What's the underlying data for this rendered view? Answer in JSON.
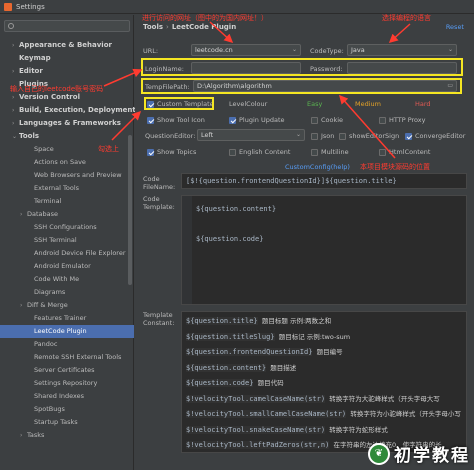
{
  "window": {
    "title": "Settings"
  },
  "search": {
    "placeholder": ""
  },
  "sidebar": {
    "items": [
      {
        "label": "Appearance & Behavior",
        "kind": "top",
        "caret": "›"
      },
      {
        "label": "Keymap",
        "kind": "top",
        "caret": ""
      },
      {
        "label": "Editor",
        "kind": "top",
        "caret": "›"
      },
      {
        "label": "Plugins",
        "kind": "top",
        "caret": ""
      },
      {
        "label": "Version Control",
        "kind": "top",
        "caret": "›"
      },
      {
        "label": "Build, Execution, Deployment",
        "kind": "top",
        "caret": "›"
      },
      {
        "label": "Languages & Frameworks",
        "kind": "top",
        "caret": "›"
      },
      {
        "label": "Tools",
        "kind": "top",
        "caret": "⌄"
      },
      {
        "label": "Space",
        "kind": "child",
        "caret": ""
      },
      {
        "label": "Actions on Save",
        "kind": "child",
        "caret": ""
      },
      {
        "label": "Web Browsers and Preview",
        "kind": "child",
        "caret": ""
      },
      {
        "label": "External Tools",
        "kind": "child",
        "caret": ""
      },
      {
        "label": "Terminal",
        "kind": "child",
        "caret": ""
      },
      {
        "label": "Database",
        "kind": "child-arrow",
        "caret": "›"
      },
      {
        "label": "SSH Configurations",
        "kind": "child",
        "caret": ""
      },
      {
        "label": "SSH Terminal",
        "kind": "child",
        "caret": ""
      },
      {
        "label": "Android Device File Explorer",
        "kind": "child",
        "caret": ""
      },
      {
        "label": "Android Emulator",
        "kind": "child",
        "caret": ""
      },
      {
        "label": "Code With Me",
        "kind": "child",
        "caret": ""
      },
      {
        "label": "Diagrams",
        "kind": "child",
        "caret": ""
      },
      {
        "label": "Diff & Merge",
        "kind": "child-arrow",
        "caret": "›"
      },
      {
        "label": "Features Trainer",
        "kind": "child",
        "caret": ""
      },
      {
        "label": "LeetCode Plugin",
        "kind": "child selected",
        "caret": ""
      },
      {
        "label": "Pandoc",
        "kind": "child",
        "caret": ""
      },
      {
        "label": "Remote SSH External Tools",
        "kind": "child",
        "caret": ""
      },
      {
        "label": "Server Certificates",
        "kind": "child",
        "caret": ""
      },
      {
        "label": "Settings Repository",
        "kind": "child",
        "caret": ""
      },
      {
        "label": "Shared Indexes",
        "kind": "child",
        "caret": ""
      },
      {
        "label": "SpotBugs",
        "kind": "child",
        "caret": ""
      },
      {
        "label": "Startup Tasks",
        "kind": "child",
        "caret": ""
      },
      {
        "label": "Tasks",
        "kind": "child-arrow",
        "caret": "›"
      }
    ]
  },
  "header": {
    "crumb1": "Tools",
    "crumb_sep": "›",
    "crumb2": "LeetCode Plugin",
    "reset": "Reset"
  },
  "form": {
    "url_label": "URL:",
    "url_value": "leetcode.cn",
    "codetype_label": "CodeType:",
    "codetype_value": "Java",
    "login_label": "LoginName:",
    "login_value": "",
    "password_label": "Password:",
    "password_value": "",
    "tempfile_label": "TempFilePath:",
    "tempfile_value": "D:\\Algorithm\\algorithm",
    "custom_template": "Custom Template",
    "level_colour": "LevelColour",
    "easy": "Easy",
    "medium": "Medium",
    "hard": "Hard",
    "show_tool_icon": "Show Tool Icon",
    "plugin_update": "Plugin Update",
    "cookie": "Cookie",
    "http_proxy": "HTTP Proxy",
    "question_editor": "QuestionEditor:",
    "question_editor_value": "Left",
    "json": "Json",
    "show_editor_sign": "showEditorSign",
    "converge_editor": "ConvergeEditor",
    "show_topics": "Show Topics",
    "english_content": "English Content",
    "multiline": "Multiline",
    "html_content": "HtmlContent",
    "custom_config": "CustomConfig(help)",
    "code_filename_label": "Code\nFileName:",
    "code_filename_value": "[$!{question.frontendQuestionId}]${question.title}",
    "code_template_label": "Code\nTemplate:",
    "template_constant_label": "Template\nConstant:"
  },
  "code_template": [
    "${question.content}",
    "",
    "${question.code}"
  ],
  "template_constants": [
    {
      "code": "${question.title}",
      "desc": "题目标题 示例:两数之和"
    },
    {
      "code": "${question.titleSlug}",
      "desc": "题目标记 示例:two-sum"
    },
    {
      "code": "${question.frontendQuestionId}",
      "desc": "题目编号"
    },
    {
      "code": "${question.content}",
      "desc": "题目描述"
    },
    {
      "code": "${question.code}",
      "desc": "题目代码"
    },
    {
      "code": "$!velocityTool.camelCaseName(str)",
      "desc": "转换字符为大驼峰样式（开头字母大写"
    },
    {
      "code": "$!velocityTool.smallCamelCaseName(str)",
      "desc": "转换字符为小驼峰样式（开头字母小写"
    },
    {
      "code": "$!velocityTool.snakeCaseName(str)",
      "desc": "转换字符为蛇形样式"
    },
    {
      "code": "$!velocityTool.leftPadZeros(str,n)",
      "desc": "在字符串的左边填充0，使字符串的长"
    }
  ],
  "annotations": {
    "url_note": "进行访问的网址（图中的为国内网址！）",
    "lang_note": "选择编程的语言",
    "login_note": "输入自己的leetcode账号密码",
    "check_note": "勾选上",
    "path_note": "本项目模块源码的位置"
  },
  "colors": {
    "easy": "#5ab350",
    "medium": "#e3a228",
    "hard": "#e05a54",
    "annotation_box": "#f5e623",
    "annotation_text": "#ff3b30"
  },
  "watermark": {
    "text": "初学教程"
  }
}
